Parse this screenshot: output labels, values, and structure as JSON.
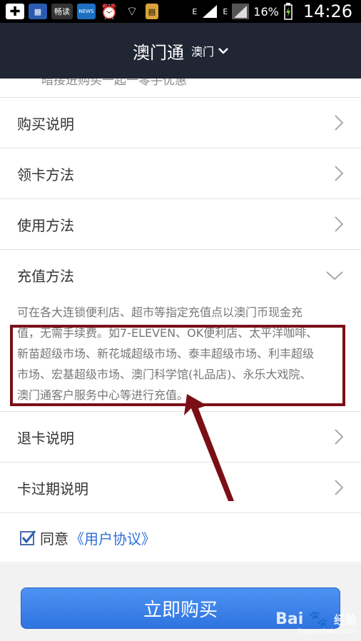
{
  "status_bar": {
    "app_label_1": "畅读",
    "app_label_2": "NEWS",
    "network_1": "E",
    "network_2": "E",
    "battery": "16%",
    "time": "14:26"
  },
  "header": {
    "title": "澳门通",
    "city": "澳门"
  },
  "partial_row_text": "暗接进购买一起一零手优惠",
  "rows": [
    {
      "label": "购买说明"
    },
    {
      "label": "领卡方法"
    },
    {
      "label": "使用方法"
    },
    {
      "label": "充值方法"
    },
    {
      "label": "退卡说明"
    },
    {
      "label": "卡过期说明"
    }
  ],
  "recharge_desc_lines": [
    "可在各大连锁便利店、超市等指定充值点以澳门币现金充",
    "值，无需手续费。如7-ELEVEN、OK便利店、太平洋咖啡、",
    "新苗超级市场、新花城超级市场、泰丰超级市场、利丰超级",
    "市场、宏基超级市场、澳门科学馆(礼品店)、永乐大戏院、",
    "澳门通客户服务中心等进行充值。"
  ],
  "agree": {
    "prefix": "同意",
    "link": "《用户协议》",
    "checked": true
  },
  "buy_button": "立即购买",
  "watermark": {
    "brand": "Bai",
    "brand_suffix": "经验",
    "url": "jingyan.baidu.com"
  },
  "colors": {
    "title_bar": "#202634",
    "highlight": "#7b0f16",
    "button": "#3b82ea",
    "link": "#2f70d8"
  }
}
